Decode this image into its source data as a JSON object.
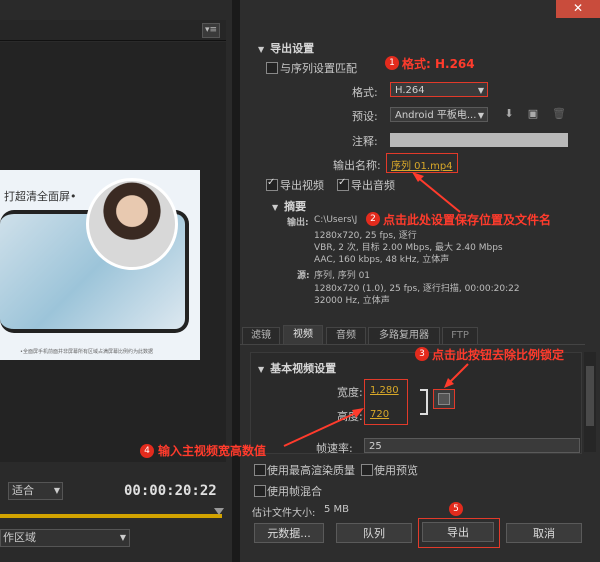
{
  "window": {
    "close_label": "✕"
  },
  "preview": {
    "headline": "打超清全面屏•",
    "footnote": "•全面屏手机前面并非屏幕所有区域占满屏幕比例约为此数据",
    "fit_select": "适合",
    "timecode": "00:00:20:22",
    "area_select": "作区域",
    "panel_menu": "▾≡"
  },
  "export_settings": {
    "title": "导出设置",
    "match_sequence_label": "与序列设置匹配",
    "format_label": "格式:",
    "format_value": "H.264",
    "preset_label": "预设:",
    "preset_value": "Android 平板电...",
    "comments_label": "注释:",
    "output_name_label": "输出名称:",
    "output_name_value": "序列 01.mp4",
    "export_video_label": "导出视频",
    "export_audio_label": "导出音频"
  },
  "summary": {
    "title": "摘要",
    "output_label": "输出:",
    "output_path": "C:\\Users\\J",
    "output_lines": [
      "1280x720, 25 fps, 逐行",
      "VBR, 2 次, 目标 2.00 Mbps, 最大 2.40 Mbps",
      "AAC, 160 kbps, 48 kHz, 立体声"
    ],
    "source_label": "源:",
    "source_name": "序列, 序列 01",
    "source_lines": [
      "1280x720 (1.0), 25 fps, 逐行扫描, 00:00:20:22",
      "32000 Hz, 立体声"
    ]
  },
  "tabs": [
    {
      "label": "滤镜"
    },
    {
      "label": "视频"
    },
    {
      "label": "音频"
    },
    {
      "label": "多路复用器"
    },
    {
      "label": "FTP"
    }
  ],
  "video": {
    "title": "基本视频设置",
    "width_label": "宽度:",
    "width_value": "1,280",
    "height_label": "高度:",
    "height_value": "720",
    "framerate_label": "帧速率:",
    "framerate_value": "25"
  },
  "options": {
    "max_render_label": "使用最高渲染质量",
    "use_preview_label": "使用预览",
    "frame_blend_label": "使用帧混合",
    "file_size_label": "估计文件大小:",
    "file_size_value": "5 MB"
  },
  "buttons": {
    "metadata": "元数据...",
    "queue": "队列",
    "export": "导出",
    "cancel": "取消"
  },
  "annotations": {
    "n1": "1",
    "t1": "格式: H.264",
    "n2": "2",
    "t2": "点击此处设置保存位置及文件名",
    "n3": "3",
    "t3": "点击此按钮去除比例锁定",
    "n4": "4",
    "t4": "输入主视频宽高数值",
    "n5": "5"
  },
  "colors": {
    "accent": "#d8a829",
    "annotation": "#e32b1d"
  }
}
